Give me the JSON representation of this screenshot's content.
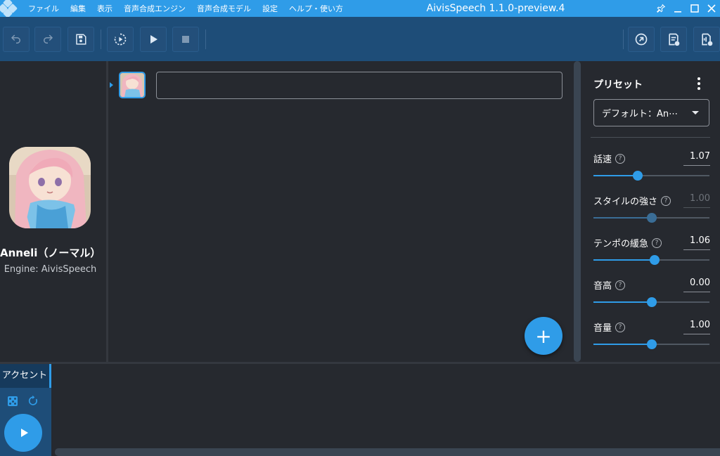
{
  "titlebar": {
    "menu": [
      "ファイル",
      "編集",
      "表示",
      "音声合成エンジン",
      "音声合成モデル",
      "設定",
      "ヘルプ・使い方"
    ],
    "window_title": "AivisSpeech 1.1.0-preview.4",
    "controls": [
      "pin-icon",
      "minimize-icon",
      "maximize-icon",
      "close-icon"
    ]
  },
  "toolbar": {
    "left_buttons": [
      "undo-icon",
      "redo-icon",
      "save-icon",
      "play-continuous-icon",
      "play-icon",
      "stop-icon"
    ],
    "right_buttons": [
      "open-link-icon",
      "export-text-icon",
      "export-audio-icon"
    ]
  },
  "character": {
    "name": "Anneli（ノーマル）",
    "engine": "Engine: AivisSpeech"
  },
  "editor": {
    "rows": [
      {
        "text": ""
      }
    ],
    "add_button": "+"
  },
  "preset": {
    "title": "プリセット",
    "selected": "デフォルト：An⋯",
    "params": [
      {
        "label": "話速",
        "value": "1.07",
        "fraction": 0.38,
        "enabled": true
      },
      {
        "label": "スタイルの強さ",
        "value": "1.00",
        "fraction": 0.5,
        "enabled": false
      },
      {
        "label": "テンポの緩急",
        "value": "1.06",
        "fraction": 0.53,
        "enabled": true
      },
      {
        "label": "音高",
        "value": "0.00",
        "fraction": 0.5,
        "enabled": true
      },
      {
        "label": "音量",
        "value": "1.00",
        "fraction": 0.5,
        "enabled": true
      }
    ]
  },
  "bottom": {
    "accent_tab": "アクセント",
    "icons": [
      "dice-icon",
      "reset-icon",
      "play-icon"
    ]
  },
  "colors": {
    "accent": "#2f9ce8",
    "toolbar": "#1e4d78",
    "background": "#26292f"
  }
}
